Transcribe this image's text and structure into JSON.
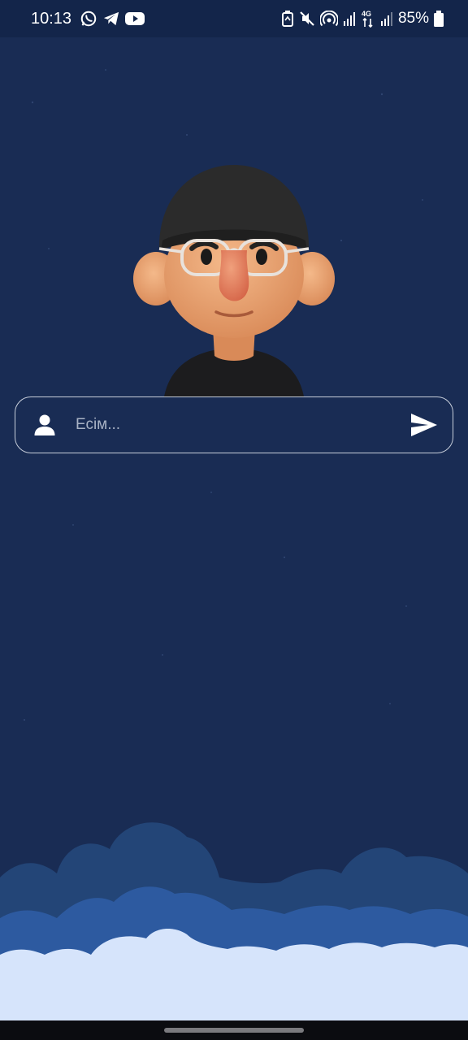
{
  "status_bar": {
    "time": "10:13",
    "battery": "85%",
    "network": "4G",
    "app_icons": [
      "whatsapp-icon",
      "telegram-icon",
      "youtube-icon"
    ],
    "system_icons": [
      "battery-saver-icon",
      "mute-icon",
      "hotspot-icon",
      "signal-icon",
      "4g-data-icon",
      "signal-icon",
      "battery-icon"
    ]
  },
  "name_input": {
    "placeholder": "Есім...",
    "value": ""
  },
  "icons": {
    "field_leading": "user-icon",
    "submit": "send-icon"
  },
  "colors": {
    "background": "#192c54",
    "status_bar": "#13254a",
    "field_border": "#c7ceda",
    "cloud_back": "#234577",
    "cloud_mid": "#2d5aa0",
    "cloud_front": "#d6e4fb"
  }
}
